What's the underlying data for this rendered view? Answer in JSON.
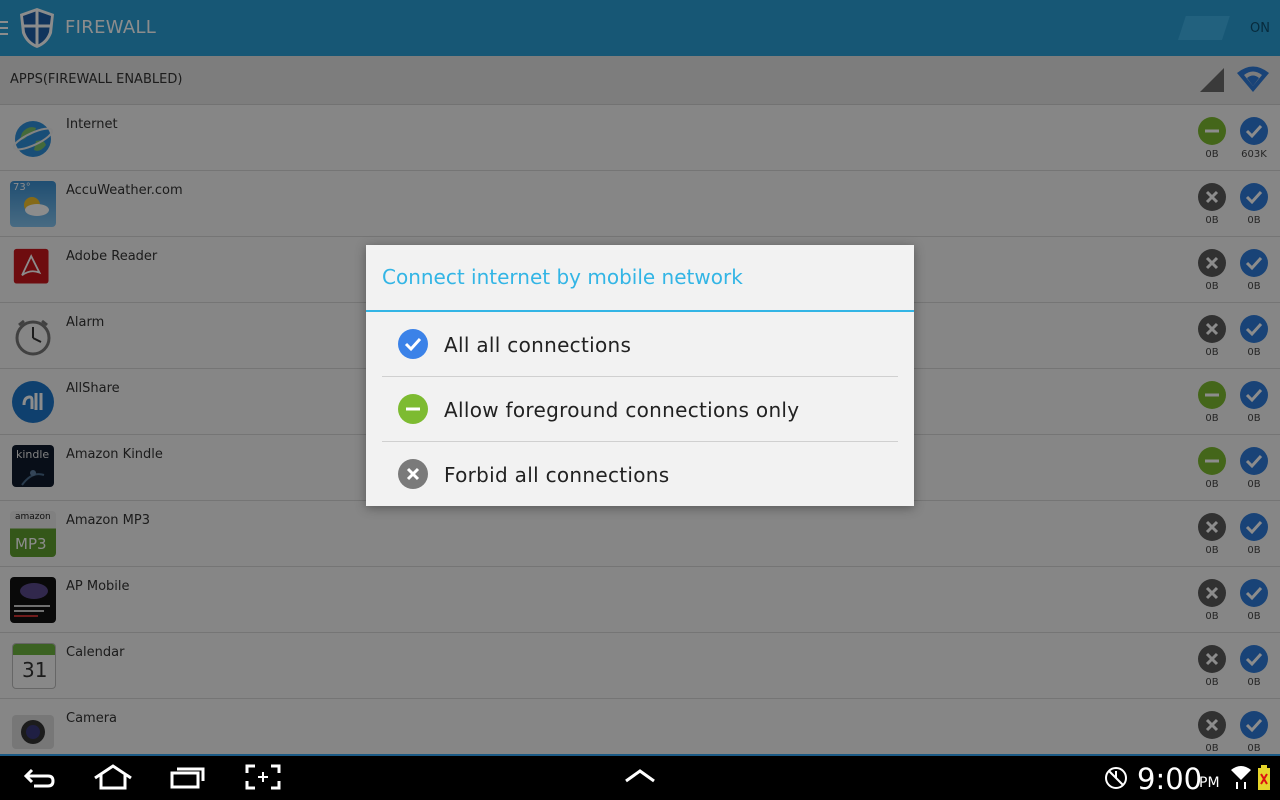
{
  "app": {
    "title": "FIREWALL",
    "toggle_label": "ON"
  },
  "list_header": {
    "label": "APPS(FIREWALL ENABLED)"
  },
  "apps": [
    {
      "name": "Internet",
      "mobile": "minus",
      "wifi": "check",
      "mobile_usage": "0B",
      "wifi_usage": "603K"
    },
    {
      "name": "AccuWeather.com",
      "mobile": "x",
      "wifi": "check",
      "mobile_usage": "0B",
      "wifi_usage": "0B"
    },
    {
      "name": "Adobe Reader",
      "mobile": "x",
      "wifi": "check",
      "mobile_usage": "0B",
      "wifi_usage": "0B"
    },
    {
      "name": "Alarm",
      "mobile": "x",
      "wifi": "check",
      "mobile_usage": "0B",
      "wifi_usage": "0B"
    },
    {
      "name": "AllShare",
      "mobile": "minus",
      "wifi": "check",
      "mobile_usage": "0B",
      "wifi_usage": "0B"
    },
    {
      "name": "Amazon Kindle",
      "mobile": "minus",
      "wifi": "check",
      "mobile_usage": "0B",
      "wifi_usage": "0B"
    },
    {
      "name": "Amazon MP3",
      "mobile": "x",
      "wifi": "check",
      "mobile_usage": "0B",
      "wifi_usage": "0B"
    },
    {
      "name": "AP Mobile",
      "mobile": "x",
      "wifi": "check",
      "mobile_usage": "0B",
      "wifi_usage": "0B"
    },
    {
      "name": "Calendar",
      "mobile": "x",
      "wifi": "check",
      "mobile_usage": "0B",
      "wifi_usage": "0B"
    },
    {
      "name": "Camera",
      "mobile": "x",
      "wifi": "check",
      "mobile_usage": "0B",
      "wifi_usage": "0B"
    }
  ],
  "app_icon_text": {
    "accuweather": "73°",
    "kindle": "kindle",
    "amazon_mp3_top": "amazon",
    "amazon_mp3": "MP3",
    "calendar_day": "31"
  },
  "dialog": {
    "title": "Connect internet by mobile network",
    "options": [
      {
        "label": "All all connections",
        "icon": "check-icon"
      },
      {
        "label": "Allow foreground connections only",
        "icon": "minus-icon"
      },
      {
        "label": "Forbid all connections",
        "icon": "x-icon"
      }
    ]
  },
  "system_bar": {
    "time": "9:00",
    "ampm": "PM"
  },
  "colors": {
    "action_bar": "#2a9fd6",
    "accent": "#33b5e5",
    "allow": "#2e7bd9",
    "foreground": "#7dbb31",
    "forbid": "#5a5a5a"
  }
}
